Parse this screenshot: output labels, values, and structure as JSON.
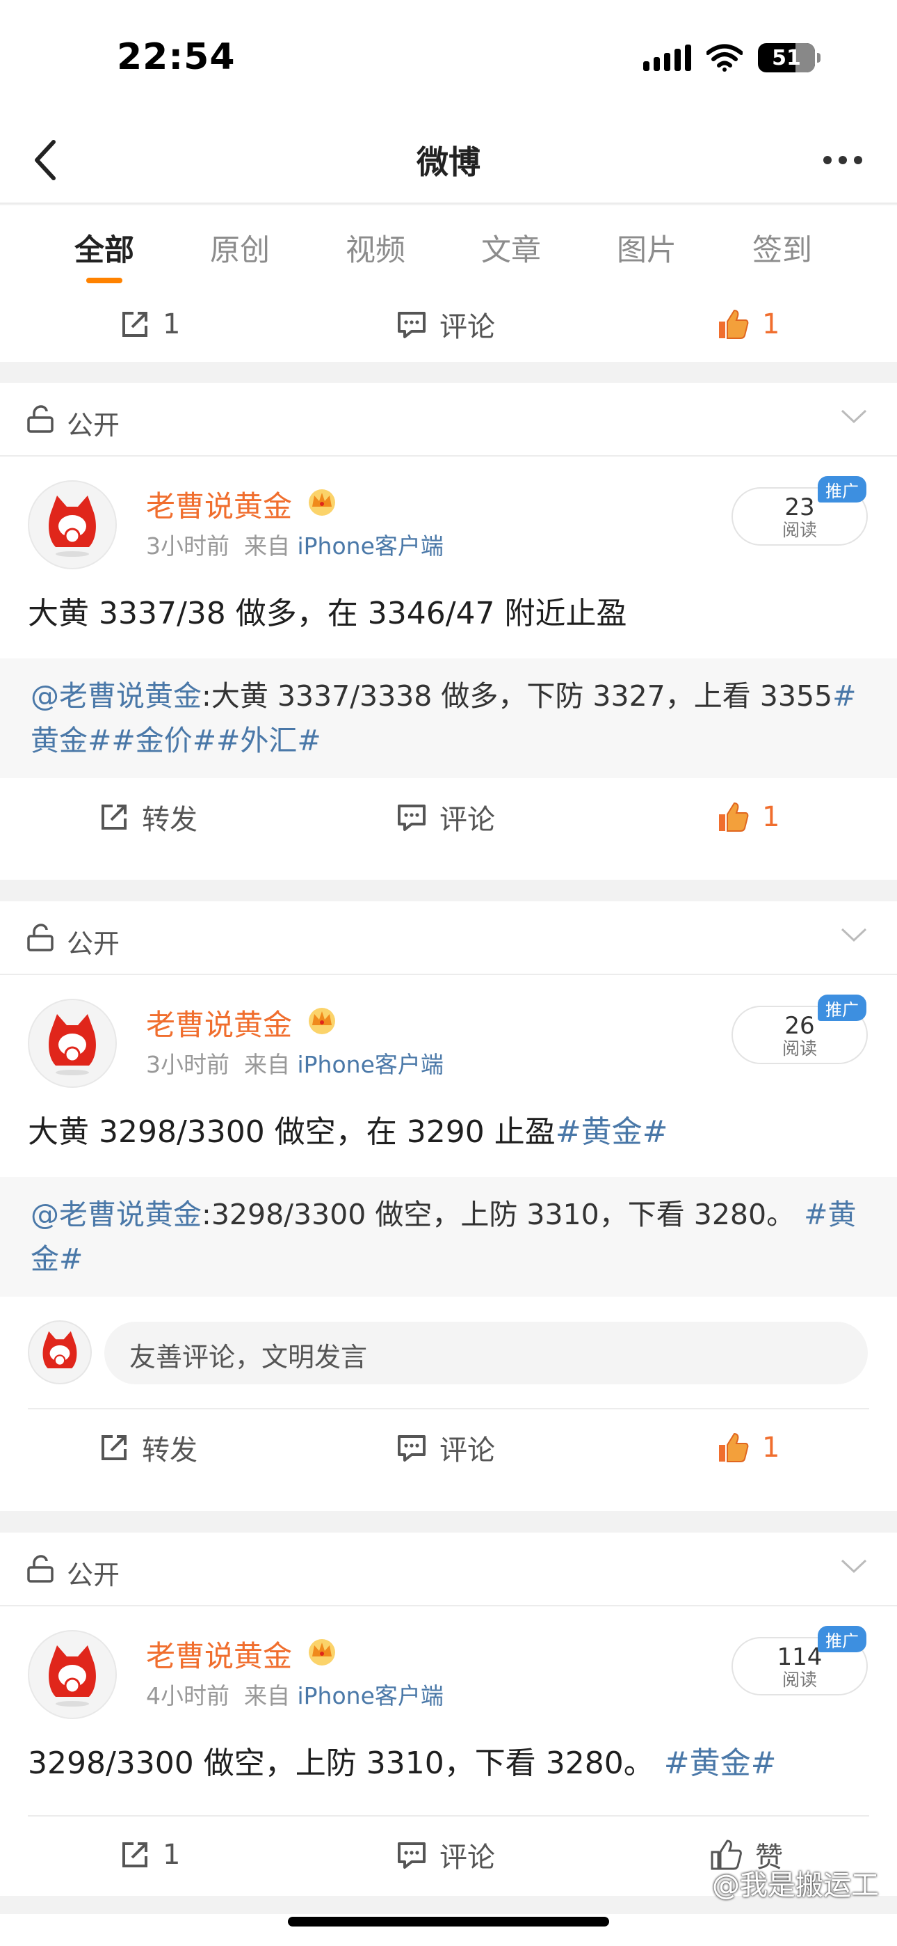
{
  "status_bar": {
    "time": "22:54",
    "battery": "51"
  },
  "nav": {
    "title": "微博"
  },
  "tabs": [
    {
      "label": "全部",
      "active": true
    },
    {
      "label": "原创"
    },
    {
      "label": "视频"
    },
    {
      "label": "文章"
    },
    {
      "label": "图片"
    },
    {
      "label": "签到"
    }
  ],
  "top_actions": {
    "repost": "1",
    "comment": "评论",
    "like": "1"
  },
  "posts": [
    {
      "visibility": "公开",
      "author": "老曹说黄金",
      "time": "3小时前",
      "from": "来自",
      "source": "iPhone客户端",
      "reads": "23",
      "reads_label": "阅读",
      "promo": "推广",
      "text": "大黄 3337/38 做多，在 3346/47 附近止盈",
      "repost_at": "@老曹说黄金",
      "repost_text": ":大黄 3337/3338 做多，下防 3327，上看 3355",
      "repost_tags": "#黄金##金价##外汇#",
      "actions": {
        "repost": "转发",
        "comment": "评论",
        "like": "1"
      }
    },
    {
      "visibility": "公开",
      "author": "老曹说黄金",
      "time": "3小时前",
      "from": "来自",
      "source": "iPhone客户端",
      "reads": "26",
      "reads_label": "阅读",
      "promo": "推广",
      "text": "大黄 3298/3300 做空，在 3290 止盈",
      "text_tag": "#黄金#",
      "repost_at": "@老曹说黄金",
      "repost_text": ":3298/3300 做空，上防 3310，下看 3280。",
      "repost_tags": "#黄金#",
      "comment_placeholder": "友善评论，文明发言",
      "actions": {
        "repost": "转发",
        "comment": "评论",
        "like": "1"
      }
    },
    {
      "visibility": "公开",
      "author": "老曹说黄金",
      "time": "4小时前",
      "from": "来自",
      "source": "iPhone客户端",
      "reads": "114",
      "reads_label": "阅读",
      "promo": "推广",
      "text": "3298/3300 做空，上防 3310，下看 3280。",
      "text_tag": "#黄金#",
      "actions": {
        "repost": "1",
        "comment": "评论",
        "like": "赞"
      }
    }
  ],
  "watermark": "@我是搬运工",
  "colors": {
    "accent": "#ff8200",
    "name": "#f06e2e",
    "link": "#4a78a8",
    "promo": "#3d8fe0"
  }
}
